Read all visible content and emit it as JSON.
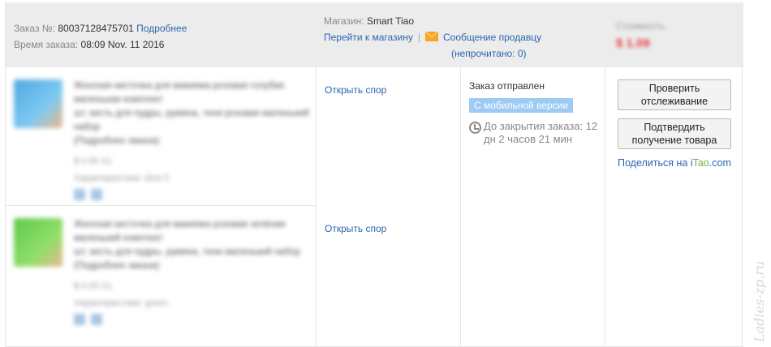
{
  "order": {
    "number_label": "Заказ №:",
    "number": "80037128475701",
    "details_link": "Подробнее",
    "time_label": "Время заказа:",
    "time": "08:09 Nov. 11 2016"
  },
  "store": {
    "label": "Магазин:",
    "name": "Smart Tiao",
    "go_to_store": "Перейти к магазину",
    "separator": "|",
    "message_seller": "Сообщение продавцу",
    "unread": "(непрочитано: 0)"
  },
  "amount": {
    "label": "Стоимость",
    "value": "$ 1.09"
  },
  "products": [
    {
      "title": "Женская кисточка для макияжа розовая голубая маленькая комплект",
      "line2": "шт. кисть для пудры, румяна, тени розовая маленький набор",
      "line3": "(Подробнее заказа)",
      "price": "$ 0.55 X1",
      "properties": "Характеристики: blue 5",
      "dispute": "Открыть спор",
      "color": "#5fb7e8"
    },
    {
      "title": "Женская кисточка для макияжа розовая зелёная маленький комплект",
      "line2": "шт. кисть для пудры, румяна, тени маленький набор",
      "line3": "(Подробнее заказа)",
      "price": "$ 0.55 X1",
      "properties": "Характеристики: green",
      "dispute": "Открыть спор",
      "color": "#6fcf4a"
    }
  ],
  "status": {
    "text": "Заказ отправлен",
    "badge": "С мобильной версии",
    "deadline": "До закрытия заказа: 12 дн 2 часов 21 мин"
  },
  "actions": {
    "tracking": "Проверить отслеживание",
    "confirm": "Подтвердить получение товара",
    "share_prefix": "Поделиться на ",
    "share_i": "i",
    "share_tao": "Tao",
    "share_domain": ".com"
  },
  "watermark": "Ladies-zp.ru",
  "colors": {
    "link": "#2a66b0",
    "header_bg": "#ececec",
    "badge_bg": "#9ecbf4",
    "amount": "#e0423b",
    "envelope": "#f5a623"
  }
}
